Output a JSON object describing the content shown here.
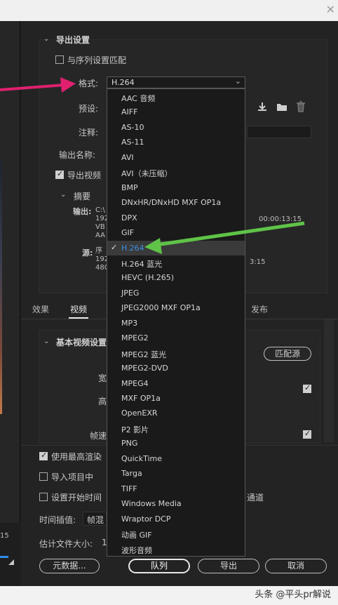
{
  "export_settings": {
    "title": "导出设置",
    "match_sequence": "与序列设置匹配",
    "format_label": "格式:",
    "format_value": "H.264",
    "preset_label": "预设:",
    "comment_label": "注释:",
    "output_name_label": "输出名称:",
    "export_video": "导出视频",
    "summary_title": "摘要",
    "output_label": "输出:",
    "output_lines": "C:\\\n192\nVB\nAA",
    "output_right": "00:00:13:15",
    "source_label": "源:",
    "source_lines": "序\n192\n480",
    "source_right": "3:15"
  },
  "tabs": [
    {
      "label": "效果"
    },
    {
      "label": "视频"
    },
    {
      "label": "发布"
    }
  ],
  "video_settings": {
    "title": "基本视频设置",
    "match_source": "匹配源",
    "width_label_partial": "宽",
    "height_label_partial": "高",
    "fps_label_partial": "帧速"
  },
  "bottom": {
    "max_render": "使用最高渲染",
    "import_project": "导入项目中",
    "set_start_tc": "设置开始时间",
    "channel_partial": "通道",
    "time_interp_label": "时间插值:",
    "time_interp_value": "帧混",
    "est_size_label": "估计文件大小:",
    "est_size_value": "1",
    "metadata_btn": "元数据...",
    "queue_btn": "队列",
    "export_btn": "导出",
    "cancel_btn": "取消"
  },
  "left_time": "15",
  "format_options": [
    "AAC 音频",
    "AIFF",
    "AS-10",
    "AS-11",
    "AVI",
    "AVI（未压缩）",
    "BMP",
    "DNxHR/DNxHD MXF OP1a",
    "DPX",
    "GIF",
    "H.264",
    "H.264 蓝光",
    "HEVC (H.265)",
    "JPEG",
    "JPEG2000 MXF OP1a",
    "MP3",
    "MPEG2",
    "MPEG2 蓝光",
    "MPEG2-DVD",
    "MPEG4",
    "MXF OP1a",
    "OpenEXR",
    "P2 影片",
    "PNG",
    "QuickTime",
    "Targa",
    "TIFF",
    "Windows Media",
    "Wraptor DCP",
    "动画 GIF",
    "波形音频"
  ],
  "selected_index": 10,
  "watermark": "头条 @平头pr解说",
  "colors": {
    "arrow_pink": "#e0206e",
    "arrow_green": "#5fc348",
    "selected_text": "#3d8de0"
  }
}
